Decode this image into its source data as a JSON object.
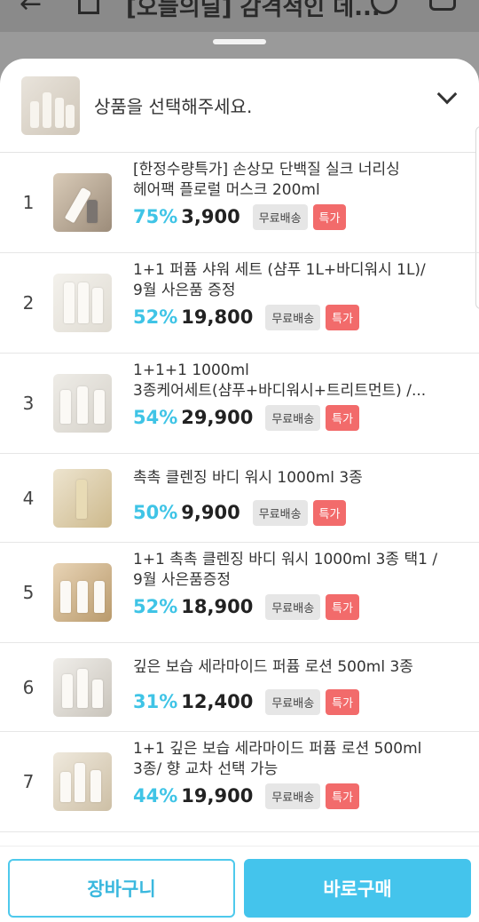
{
  "header": {
    "title": "[오늘의딜] 감격적인 데..."
  },
  "selector": {
    "label": "상품을 선택해주세요."
  },
  "items": [
    {
      "rank": "1",
      "name_line1": "[한정수량특가] 손상모 단백질 실크 너리싱",
      "name_line2": "헤어팩 플로럴 머스크 200ml",
      "discount": "75%",
      "price": "3,900",
      "free_shipping": "무료배송",
      "special": "특가"
    },
    {
      "rank": "2",
      "name_line1": "1+1 퍼퓸 샤워 세트 (샴푸 1L+바디워시 1L)/",
      "name_line2": "9월 사은품 증정",
      "discount": "52%",
      "price": "19,800",
      "free_shipping": "무료배송",
      "special": "특가"
    },
    {
      "rank": "3",
      "name_line1": "1+1+1 1000ml",
      "name_line2": "3종케어세트(샴푸+바디워시+트리트먼트) /...",
      "discount": "54%",
      "price": "29,900",
      "free_shipping": "무료배송",
      "special": "특가"
    },
    {
      "rank": "4",
      "name_line1": "촉촉 클렌징 바디 워시 1000ml 3종",
      "name_line2": "",
      "discount": "50%",
      "price": "9,900",
      "free_shipping": "무료배송",
      "special": "특가"
    },
    {
      "rank": "5",
      "name_line1": "1+1 촉촉 클렌징 바디 워시 1000ml 3종 택1 /",
      "name_line2": "9월 사은품증정",
      "discount": "52%",
      "price": "18,900",
      "free_shipping": "무료배송",
      "special": "특가"
    },
    {
      "rank": "6",
      "name_line1": "깊은 보습 세라마이드 퍼퓸 로션 500ml 3종",
      "name_line2": "",
      "discount": "31%",
      "price": "12,400",
      "free_shipping": "무료배송",
      "special": "특가"
    },
    {
      "rank": "7",
      "name_line1": "1+1 깊은 보습 세라마이드 퍼퓸 로션 500ml",
      "name_line2": "3종/ 향 교차 선택 가능",
      "discount": "44%",
      "price": "19,900",
      "free_shipping": "무료배송",
      "special": "특가"
    }
  ],
  "buttons": {
    "cart": "장바구니",
    "buy": "바로구매"
  },
  "colors": {
    "accent": "#44c4ec",
    "discount": "#3fc4e6",
    "special_badge": "#f26b6b"
  }
}
